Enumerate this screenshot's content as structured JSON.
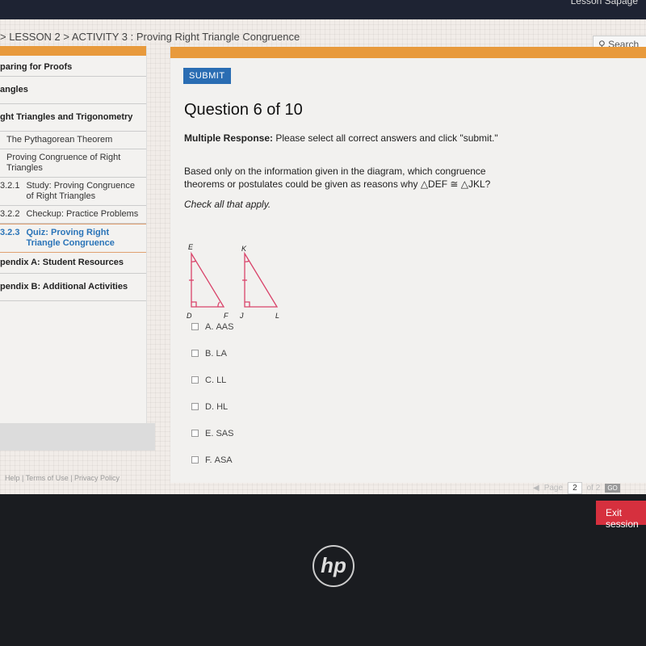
{
  "topbar": {
    "right_text": "Lesson Sapage"
  },
  "breadcrumb": "> LESSON 2 > ACTIVITY 3 : Proving Right Triangle Congruence",
  "search_label": "Search",
  "sidebar": {
    "items": [
      {
        "label": "paring for Proofs"
      },
      {
        "label": "angles"
      },
      {
        "label": "ght Triangles and Trigonometry"
      },
      {
        "label": "The Pythagorean Theorem"
      },
      {
        "label": "Proving Congruence of Right Triangles"
      },
      {
        "num": "3.2.1",
        "label": "Study: Proving Congruence of Right Triangles"
      },
      {
        "num": "3.2.2",
        "label": "Checkup: Practice Problems"
      },
      {
        "num": "3.2.3",
        "label": "Quiz: Proving Right Triangle Congruence"
      },
      {
        "label": "pendix A: Student Resources"
      },
      {
        "label": "pendix B: Additional Activities"
      }
    ]
  },
  "footer_links": "Help | Terms of Use | Privacy Policy",
  "main": {
    "submit": "SUBMIT",
    "title": "Question 6 of 10",
    "type_bold": "Multiple Response:",
    "type_text": " Please select all correct answers and click \"submit.\"",
    "question": "Based only on the information given in the diagram, which congruence theorems or postulates could be given as reasons why △DEF ≅ △JKL?",
    "hint": "Check all that apply.",
    "diagram_labels": {
      "E": "E",
      "D": "D",
      "F": "F",
      "K": "K",
      "J": "J",
      "L": "L"
    },
    "options": [
      {
        "letter": "A.",
        "text": "AAS"
      },
      {
        "letter": "B.",
        "text": "LA"
      },
      {
        "letter": "C.",
        "text": "LL"
      },
      {
        "letter": "D.",
        "text": "HL"
      },
      {
        "letter": "E.",
        "text": "SAS"
      },
      {
        "letter": "F.",
        "text": "ASA"
      }
    ]
  },
  "pager": {
    "label": "Page",
    "current": "2",
    "of": "of 2",
    "go": "GO"
  },
  "exit": "Exit session",
  "logo": "hp",
  "colors": {
    "accent": "#e89a3c",
    "submit": "#2a6db3",
    "exit": "#d6303e",
    "triangle": "#d9436a"
  }
}
